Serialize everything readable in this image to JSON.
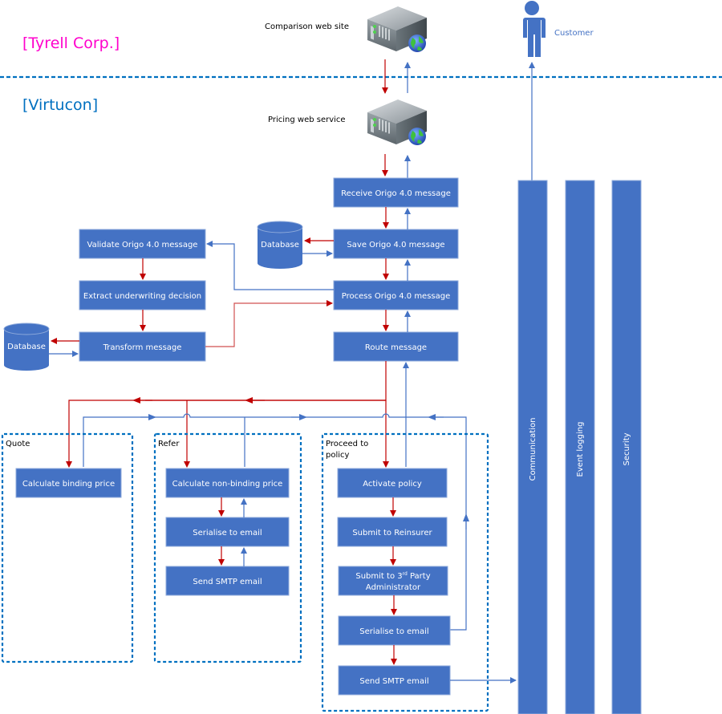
{
  "orgs": {
    "external": {
      "label": "[Tyrell Corp.]",
      "color": "#ff00cc"
    },
    "internal": {
      "label": "[Virtucon]",
      "color": "#0070c0"
    }
  },
  "servers": {
    "comparison": {
      "label": "Comparison web site",
      "icon": "web-server-icon"
    },
    "pricing": {
      "label": "Pricing web service",
      "icon": "web-server-icon"
    }
  },
  "customer": {
    "label": "Customer",
    "icon": "person-icon"
  },
  "pipeline": {
    "receive": "Receive Origo 4.0 message",
    "save": "Save Origo 4.0 message",
    "process": "Process Origo 4.0 message",
    "route": "Route message"
  },
  "databases": {
    "save_db": "Database",
    "transform_db": "Database"
  },
  "underwriting": {
    "validate": "Validate Origo 4.0 message",
    "extract": "Extract underwriting decision",
    "transform": "Transform message"
  },
  "groups": {
    "quote": {
      "label": "Quote",
      "steps": [
        "Calculate binding price"
      ]
    },
    "refer": {
      "label": "Refer",
      "steps": [
        "Calculate non-binding price",
        "Serialise to email",
        "Send SMTP email"
      ]
    },
    "policy": {
      "label_line1": "Proceed to",
      "label_line2": "policy",
      "steps": [
        "Activate policy",
        "Submit to Reinsurer",
        "Submit to 3",
        "rd",
        " Party",
        "Administrator",
        "Serialise to email",
        "Send SMTP email"
      ]
    }
  },
  "services": [
    "Communication",
    "Event logging",
    "Security"
  ],
  "colors": {
    "box_fill": "#4472c4",
    "request_arrow": "#c00000",
    "response_arrow": "#4472c4",
    "dashed_border": "#0070c0"
  }
}
